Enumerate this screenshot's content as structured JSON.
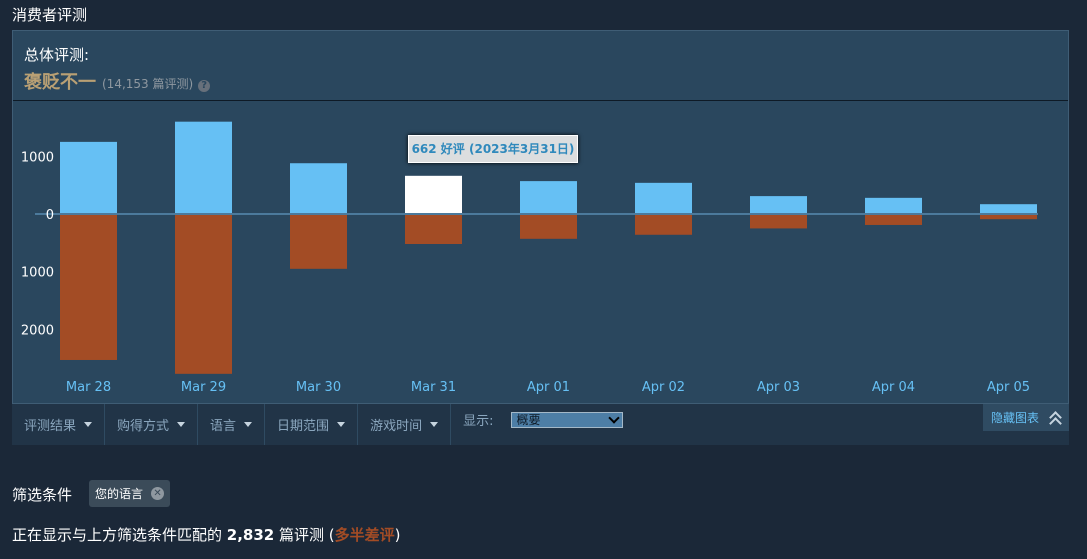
{
  "section_title": "消费者评测",
  "summary": {
    "label": "总体评测:",
    "score": "褒贬不一",
    "count": "(14,153 篇评测)",
    "help_icon": "help-circle-icon"
  },
  "tooltip": "662 好评 (2023年3月31日)",
  "chart_data": {
    "type": "bar",
    "categories": [
      "Mar 28",
      "Mar 29",
      "Mar 30",
      "Mar 31",
      "Apr 01",
      "Apr 02",
      "Apr 03",
      "Apr 04",
      "Apr 05"
    ],
    "series": [
      {
        "name": "",
        "values": [
          1250,
          1600,
          880,
          662,
          570,
          540,
          310,
          280,
          170
        ],
        "color": "#66c0f4"
      },
      {
        "name": "",
        "values": [
          -2530,
          -2770,
          -950,
          -520,
          -430,
          -360,
          -250,
          -190,
          -90
        ],
        "color": "#a34c25"
      }
    ],
    "highlight_index": 3,
    "highlight_color": "#ffffff",
    "ylim": [
      -2800,
      1700
    ],
    "yticks": [
      1000,
      0,
      -1000,
      -2000
    ],
    "ytick_labels": [
      "1000",
      "0",
      "1000",
      "2000"
    ],
    "zero_line_color": "#4c7a9c",
    "title": "",
    "xlabel": "",
    "ylabel": ""
  },
  "filters": [
    {
      "label": "评测结果"
    },
    {
      "label": "购得方式"
    },
    {
      "label": "语言"
    },
    {
      "label": "日期范围"
    },
    {
      "label": "游戏时间"
    }
  ],
  "display": {
    "label": "显示:",
    "value": "概要"
  },
  "hide_graph": "隐藏图表",
  "active_filters": {
    "label": "筛选条件",
    "chip": "您的语言"
  },
  "showing": {
    "prefix": "正在显示与上方筛选条件匹配的",
    "count": "2,832",
    "suffix": "篇评测 (",
    "rating": "多半差评",
    "close": ")"
  }
}
